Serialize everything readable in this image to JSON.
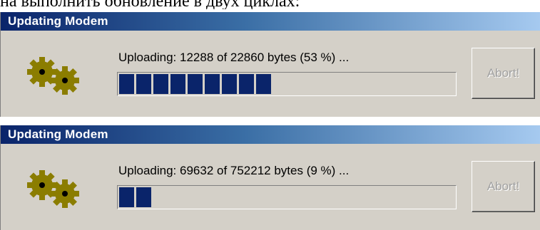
{
  "header_text": "на выполнить обновление в двух циклах:",
  "dialogs": [
    {
      "title": "Updating Modem",
      "status": "Uploading: 12288 of 22860 bytes (53 %) ...",
      "progress_blocks": 9,
      "abort_label": "Abort!"
    },
    {
      "title": "Updating Modem",
      "status": "Uploading: 69632 of 752212 bytes (9 %) ...",
      "progress_blocks": 2,
      "abort_label": "Abort!"
    }
  ],
  "colors": {
    "title_start": "#0a246a",
    "title_end": "#a6caf0",
    "progress_fill": "#0a246a",
    "dialog_bg": "#d4d0c8",
    "gear": "#8b7d00"
  },
  "icons": [
    "gears-icon"
  ]
}
